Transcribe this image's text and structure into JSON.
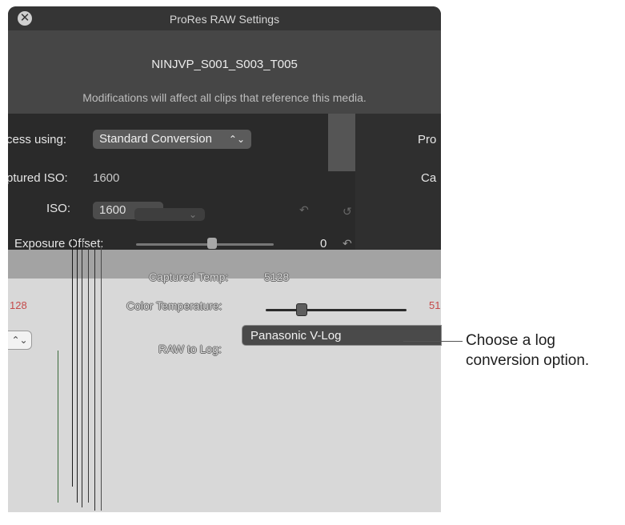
{
  "window": {
    "title": "ProRes RAW Settings",
    "clip_name": "NINJVP_S001_S003_T005",
    "warning": "Modifications will affect all clips that reference this media."
  },
  "settings_left": {
    "process_label": "cess using:",
    "process_value": "Standard Conversion",
    "captured_iso_label": "ptured ISO:",
    "captured_iso_value": "1600",
    "iso_label": "ISO:",
    "iso_value": "1600",
    "exposure_label": "Exposure Offset:",
    "exposure_value": "0",
    "exposure_level": 0.55
  },
  "settings_right": {
    "process_label_cut": "Pro",
    "captured_label_cut": "Ca"
  },
  "settings_lower": {
    "captured_temp_label": "Captured Temp:",
    "captured_temp_value": "5128",
    "color_temp_label": "Color Temperature:",
    "color_temp_left_value": "128",
    "color_temp_right_value": "51",
    "raw_to_log_label": "RAW to Log:",
    "raw_to_log_value": "Panasonic V-Log",
    "color_temp_level": 0.25
  },
  "callout": {
    "text": "Choose a log conversion option."
  },
  "icons": {
    "close": "close-icon",
    "chevron": "updown-chevron-icon",
    "reset": "reset-arrow-icon"
  },
  "colors": {
    "panel_dark": "#2a2a2a",
    "header": "#464646",
    "lower_panel": "#d8d8d8"
  }
}
